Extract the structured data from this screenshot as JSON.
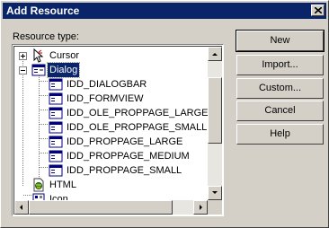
{
  "window": {
    "title": "Add Resource",
    "close_label": "X"
  },
  "resource_type_label": "Resource type:",
  "tree": {
    "items": [
      {
        "label": "Cursor",
        "icon": "cursor-icon",
        "expander": "plus",
        "level": 0
      },
      {
        "label": "Dialog",
        "icon": "dialog-icon",
        "expander": "minus",
        "level": 0,
        "selected": true
      },
      {
        "label": "IDD_DIALOGBAR",
        "icon": "dialog-template-icon",
        "level": 1
      },
      {
        "label": "IDD_FORMVIEW",
        "icon": "dialog-template-icon",
        "level": 1
      },
      {
        "label": "IDD_OLE_PROPPAGE_LARGE",
        "icon": "dialog-template-icon",
        "level": 1
      },
      {
        "label": "IDD_OLE_PROPPAGE_SMALL",
        "icon": "dialog-template-icon",
        "level": 1
      },
      {
        "label": "IDD_PROPPAGE_LARGE",
        "icon": "dialog-template-icon",
        "level": 1
      },
      {
        "label": "IDD_PROPPAGE_MEDIUM",
        "icon": "dialog-template-icon",
        "level": 1
      },
      {
        "label": "IDD_PROPPAGE_SMALL",
        "icon": "dialog-template-icon",
        "level": 1
      },
      {
        "label": "HTML",
        "icon": "html-icon",
        "level": 0
      },
      {
        "label": "Icon",
        "icon": "icon-resource-icon",
        "level": 0
      }
    ]
  },
  "buttons": {
    "new": "New",
    "import": "Import...",
    "custom": "Custom...",
    "cancel": "Cancel",
    "help": "Help"
  },
  "colors": {
    "title_bar": "#0a246a",
    "dialog_bg": "#d4d0c8",
    "selection": "#0a246a"
  }
}
